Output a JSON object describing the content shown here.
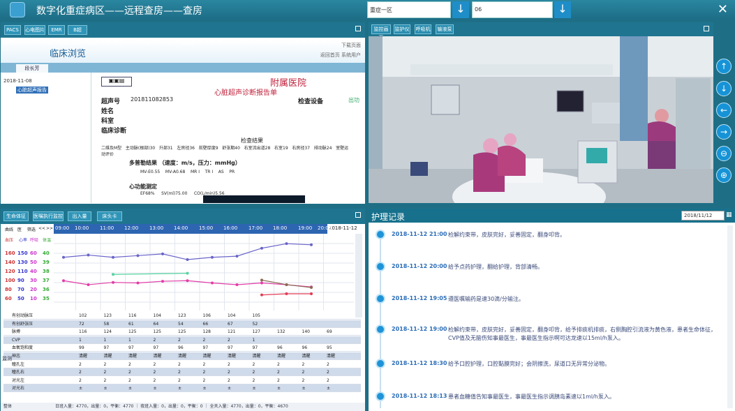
{
  "app": {
    "title": "数字化重症病区——远程查房——查房",
    "ward_select": "重症一区",
    "bed_select": "06"
  },
  "doc_panel": {
    "buttons": [
      "PACS",
      "心电图片",
      "EMR",
      "B超"
    ],
    "header_title": "临床浏览",
    "top_links": [
      "下载页面",
      "返回首页",
      "系统用户"
    ],
    "tab": "段长芳",
    "tree": {
      "date": "2018-11-08",
      "item": "心脏超声报告"
    },
    "report": {
      "hospital": "附属医院",
      "title": "心脏超声诊断报告单",
      "fields": [
        {
          "label": "超声号",
          "value": "201811082853"
        },
        {
          "label": "检查设备",
          "value": "出功"
        },
        {
          "label": "姓名",
          "value": ""
        },
        {
          "label": "科室",
          "value": ""
        },
        {
          "label": "临床诊断",
          "value": ""
        }
      ],
      "section_results": "检查结果",
      "doppler": "多普勒结果 （速度：m/s，压力：mmHg）",
      "function": "心功能测定",
      "small_labels": [
        "二维及M型",
        "主动脉(根部)30",
        "升部31",
        "左房径36",
        "前壁厚度9",
        "舒张期40",
        "右室流出道28",
        "右室19",
        "右房径37",
        "排动脉24",
        "室壁运动评价"
      ],
      "velocities": [
        "MV-E0.55",
        "MV-A0.68",
        "MR I",
        "TR I",
        "AS",
        "PR",
        "EF68%",
        "SV(ml)75.00",
        "CO(L/min)5.56"
      ]
    }
  },
  "video_panel": {
    "buttons": [
      "监控画面",
      "监护仪",
      "呼吸机",
      "输液泵"
    ]
  },
  "camera_controls": [
    "up-arrow",
    "down-arrow",
    "left-arrow",
    "right-arrow",
    "zoom-out",
    "zoom-in"
  ],
  "vitals_panel": {
    "buttons": [
      "生命体征",
      "医嘱执行监控",
      "出入量",
      "床头卡"
    ],
    "legend_cols": [
      "血压",
      "心率",
      "呼吸",
      "体温"
    ],
    "header_cells": [
      "曲线",
      "医",
      "筛选",
      "<<",
      ">>"
    ],
    "date": "2018-11-12",
    "times": [
      "09:00",
      "10:00",
      "11:00",
      "12:00",
      "13:00",
      "14:00",
      "15:00",
      "16:00",
      "17:00",
      "18:00",
      "19:00",
      "20:00"
    ],
    "scale_rows": [
      [
        "160",
        "150",
        "60",
        "40"
      ],
      [
        "140",
        "130",
        "50",
        "39"
      ],
      [
        "120",
        "110",
        "40",
        "38"
      ],
      [
        "100",
        "90",
        "30",
        "37"
      ],
      [
        "80",
        "70",
        "20",
        "36"
      ],
      [
        "60",
        "50",
        "10",
        "35"
      ]
    ],
    "table_rows": [
      {
        "label": "有创动脉压",
        "vals": [
          "102",
          "123",
          "116",
          "104",
          "123",
          "106",
          "104",
          "105",
          "",
          "",
          ""
        ]
      },
      {
        "label": "有创舒张压",
        "vals": [
          "72",
          "58",
          "61",
          "64",
          "54",
          "66",
          "67",
          "52",
          "",
          "",
          ""
        ]
      },
      {
        "label": "脉搏",
        "vals": [
          "116",
          "124",
          "125",
          "125",
          "125",
          "128",
          "121",
          "127",
          "132",
          "140",
          "69"
        ]
      },
      {
        "label": "CVP",
        "vals": [
          "1",
          "1",
          "1",
          "2",
          "2",
          "2",
          "2",
          "1",
          "",
          "",
          ""
        ]
      },
      {
        "label": "血氧饱和度",
        "vals": [
          "99",
          "97",
          "97",
          "97",
          "96",
          "97",
          "97",
          "97",
          "96",
          "96",
          "95"
        ]
      },
      {
        "label": "神志",
        "vals": [
          "清醒",
          "清醒",
          "清醒",
          "清醒",
          "清醒",
          "清醒",
          "清醒",
          "清醒",
          "清醒",
          "清醒",
          "清醒"
        ]
      },
      {
        "label": "瞳孔左",
        "vals": [
          "2",
          "2",
          "2",
          "2",
          "2",
          "2",
          "2",
          "2",
          "2",
          "2",
          "2"
        ]
      },
      {
        "label": "瞳孔右",
        "vals": [
          "2",
          "2",
          "2",
          "2",
          "2",
          "2",
          "2",
          "2",
          "2",
          "2",
          "2"
        ]
      },
      {
        "label": "对光左",
        "vals": [
          "2",
          "2",
          "2",
          "2",
          "2",
          "2",
          "2",
          "2",
          "2",
          "2",
          "2"
        ]
      },
      {
        "label": "对光右",
        "vals": [
          "±",
          "±",
          "±",
          "±",
          "±",
          "±",
          "±",
          "±",
          "±",
          "±",
          "±"
        ]
      }
    ],
    "side_label": "监测",
    "footer": "日班入量：4770，出量：0，平衡：4770 ｜ 夜班入量：0，出量：0，平衡：0 ｜ 全天入量：4770，出量：0，平衡：4670",
    "footer_left": "整体",
    "chart_data": {
      "type": "line",
      "x": [
        "10:00",
        "11:00",
        "12:00",
        "13:00",
        "14:00",
        "15:00",
        "16:00",
        "17:00",
        "18:00",
        "19:00",
        "20:00"
      ],
      "series": [
        {
          "color": "#6a64c9",
          "values": [
            136,
            140,
            136,
            139,
            142,
            132,
            136,
            138,
            152,
            160,
            158
          ]
        },
        {
          "color": "#e23ca6",
          "values": [
            95,
            88,
            92,
            91,
            94,
            95,
            91,
            88,
            91,
            88,
            84
          ]
        },
        {
          "color": "#55d49f",
          "values": [
            null,
            null,
            106,
            null,
            null,
            108,
            null,
            null,
            null,
            null,
            null
          ]
        },
        {
          "color": "#8a6a52",
          "values": [
            null,
            null,
            null,
            null,
            null,
            null,
            null,
            null,
            96,
            88,
            83
          ]
        },
        {
          "color": "#e33b55",
          "values": [
            null,
            null,
            null,
            null,
            null,
            null,
            null,
            null,
            70,
            72,
            72
          ]
        }
      ],
      "ylim": [
        50,
        170
      ]
    }
  },
  "nursing": {
    "title": "护理记录",
    "date_input": "2018/11/12",
    "records": [
      {
        "time": "2018-11-12  21:00",
        "text": "检解约束带，皮肤完好，妥善固定，翻身叩背。"
      },
      {
        "time": "2018-11-12  20:00",
        "text": "给予点药护理，翻给护理，背部清畅。"
      },
      {
        "time": "2018-11-12  19:05",
        "text": "遵医嘱输药是速30滴/分输注。"
      },
      {
        "time": "2018-11-12  19:00",
        "text": "检解约束带，皮肤完好，妥善固定，翻身叩背，给予排痰机排痰，右侧胸腔引流液为黄色液，患者生命体征，CVP值及无脑伤知事最医生，事最医生指示啊可达龙速以15ml/h泵入。"
      },
      {
        "time": "2018-11-12  18:30",
        "text": "给予口腔护理，口腔黏膜完好；会阴擦洗，尿道口无异常分泌物。"
      },
      {
        "time": "2018-11-12  18:13",
        "text": "患者血糖值告知事最医生，事最医生指示调胰岛素速以1ml/h泵入。"
      }
    ]
  }
}
